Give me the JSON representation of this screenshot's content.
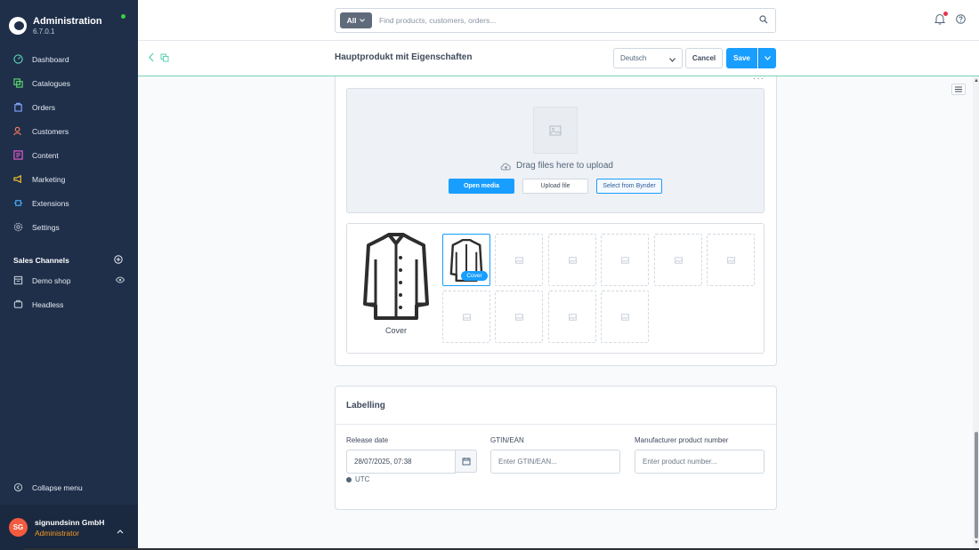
{
  "app": {
    "title": "Administration",
    "version": "6.7.0.1",
    "colors": {
      "sidebar": "#1f2f4a",
      "accent": "#189eff",
      "online": "#37d046"
    }
  },
  "nav": {
    "items": [
      {
        "label": "Dashboard",
        "icon": "dashboard-icon",
        "color": "#5bd0b1"
      },
      {
        "label": "Catalogues",
        "icon": "catalogue-icon",
        "color": "#5bd06a"
      },
      {
        "label": "Orders",
        "icon": "orders-icon",
        "color": "#7ea3f5"
      },
      {
        "label": "Customers",
        "icon": "customers-icon",
        "color": "#f47c5c"
      },
      {
        "label": "Content",
        "icon": "content-icon",
        "color": "#e55ad0"
      },
      {
        "label": "Marketing",
        "icon": "marketing-icon",
        "color": "#f5c227"
      },
      {
        "label": "Extensions",
        "icon": "extensions-icon",
        "color": "#47a8f0"
      },
      {
        "label": "Settings",
        "icon": "settings-icon",
        "color": "#a9b3c2"
      }
    ],
    "sales_channels_title": "Sales Channels",
    "sales_channels": [
      {
        "label": "Demo shop",
        "icon": "storefront-icon"
      },
      {
        "label": "Headless",
        "icon": "headless-icon"
      }
    ],
    "collapse_label": "Collapse menu"
  },
  "user": {
    "initials": "SG",
    "name": "signundsinn GmbH",
    "role": "Administrator"
  },
  "search": {
    "type_label": "All",
    "placeholder": "Find products, customers, orders..."
  },
  "smartbar": {
    "title": "Hauptprodukt mit Eigenschaften",
    "language": "Deutsch",
    "cancel_label": "Cancel",
    "save_label": "Save"
  },
  "media": {
    "drop_text": "Drag files here to upload",
    "open_media_label": "Open media",
    "upload_file_label": "Upload file",
    "bynder_label": "Select from Bynder",
    "cover_label": "Cover",
    "cover_badge": "Cover"
  },
  "labelling": {
    "title": "Labelling",
    "release_date_label": "Release date",
    "release_date_value": "28/07/2025, 07:38",
    "timezone": "UTC",
    "gtin_label": "GTIN/EAN",
    "gtin_placeholder": "Enter GTIN/EAN...",
    "mpn_label": "Manufacturer product number",
    "mpn_placeholder": "Enter product number..."
  }
}
